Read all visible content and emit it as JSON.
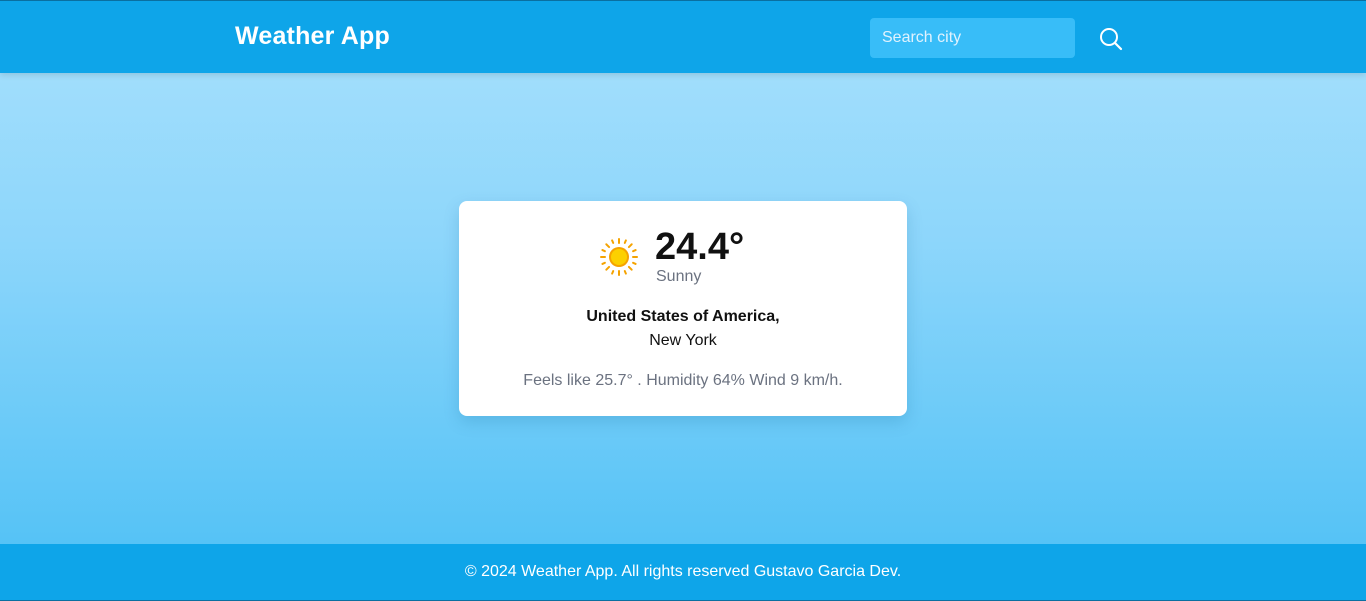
{
  "header": {
    "title": "Weather App",
    "search_placeholder": "Search city",
    "search_value": ""
  },
  "weather": {
    "icon": "sun-icon",
    "temperature": "24.4°",
    "condition": "Sunny",
    "country": "United States of America,",
    "city": "New York",
    "details": "Feels like 25.7° . Humidity 64% Wind 9 km/h."
  },
  "footer": {
    "text": "© 2024 Weather App. All rights reserved Gustavo Garcia Dev."
  },
  "colors": {
    "header_bg": "#0ea5e9",
    "search_bg": "#38bdf8",
    "sun": "#fcd000",
    "sun_rays": "#f5a300"
  }
}
